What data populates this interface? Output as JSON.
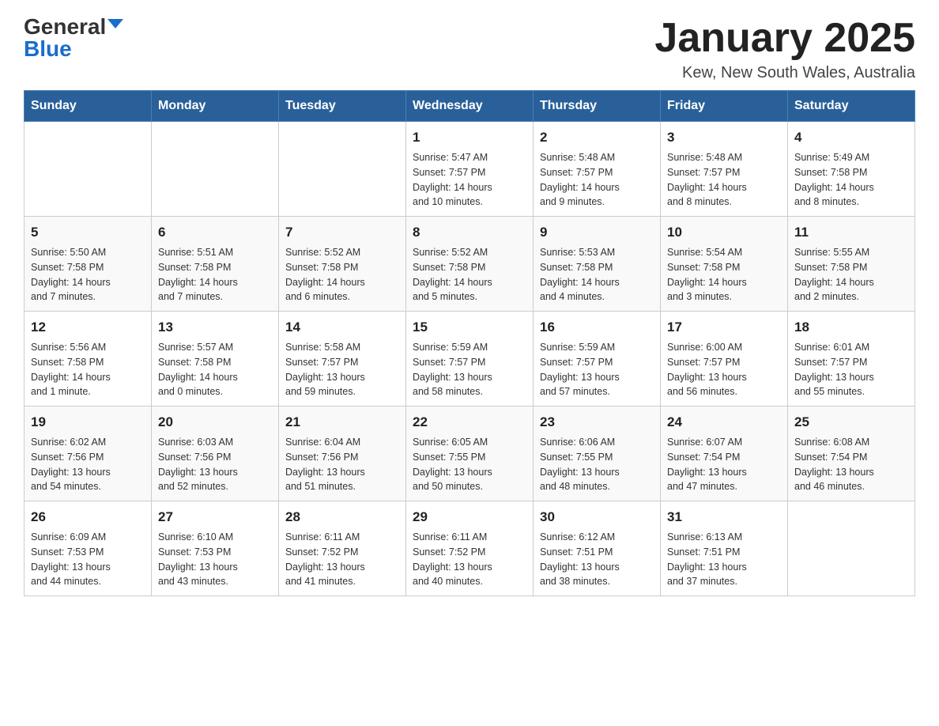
{
  "header": {
    "logo": {
      "general": "General",
      "blue": "Blue"
    },
    "month_title": "January 2025",
    "location": "Kew, New South Wales, Australia"
  },
  "days_of_week": [
    "Sunday",
    "Monday",
    "Tuesday",
    "Wednesday",
    "Thursday",
    "Friday",
    "Saturday"
  ],
  "weeks": [
    [
      {
        "day": "",
        "info": ""
      },
      {
        "day": "",
        "info": ""
      },
      {
        "day": "",
        "info": ""
      },
      {
        "day": "1",
        "info": "Sunrise: 5:47 AM\nSunset: 7:57 PM\nDaylight: 14 hours\nand 10 minutes."
      },
      {
        "day": "2",
        "info": "Sunrise: 5:48 AM\nSunset: 7:57 PM\nDaylight: 14 hours\nand 9 minutes."
      },
      {
        "day": "3",
        "info": "Sunrise: 5:48 AM\nSunset: 7:57 PM\nDaylight: 14 hours\nand 8 minutes."
      },
      {
        "day": "4",
        "info": "Sunrise: 5:49 AM\nSunset: 7:58 PM\nDaylight: 14 hours\nand 8 minutes."
      }
    ],
    [
      {
        "day": "5",
        "info": "Sunrise: 5:50 AM\nSunset: 7:58 PM\nDaylight: 14 hours\nand 7 minutes."
      },
      {
        "day": "6",
        "info": "Sunrise: 5:51 AM\nSunset: 7:58 PM\nDaylight: 14 hours\nand 7 minutes."
      },
      {
        "day": "7",
        "info": "Sunrise: 5:52 AM\nSunset: 7:58 PM\nDaylight: 14 hours\nand 6 minutes."
      },
      {
        "day": "8",
        "info": "Sunrise: 5:52 AM\nSunset: 7:58 PM\nDaylight: 14 hours\nand 5 minutes."
      },
      {
        "day": "9",
        "info": "Sunrise: 5:53 AM\nSunset: 7:58 PM\nDaylight: 14 hours\nand 4 minutes."
      },
      {
        "day": "10",
        "info": "Sunrise: 5:54 AM\nSunset: 7:58 PM\nDaylight: 14 hours\nand 3 minutes."
      },
      {
        "day": "11",
        "info": "Sunrise: 5:55 AM\nSunset: 7:58 PM\nDaylight: 14 hours\nand 2 minutes."
      }
    ],
    [
      {
        "day": "12",
        "info": "Sunrise: 5:56 AM\nSunset: 7:58 PM\nDaylight: 14 hours\nand 1 minute."
      },
      {
        "day": "13",
        "info": "Sunrise: 5:57 AM\nSunset: 7:58 PM\nDaylight: 14 hours\nand 0 minutes."
      },
      {
        "day": "14",
        "info": "Sunrise: 5:58 AM\nSunset: 7:57 PM\nDaylight: 13 hours\nand 59 minutes."
      },
      {
        "day": "15",
        "info": "Sunrise: 5:59 AM\nSunset: 7:57 PM\nDaylight: 13 hours\nand 58 minutes."
      },
      {
        "day": "16",
        "info": "Sunrise: 5:59 AM\nSunset: 7:57 PM\nDaylight: 13 hours\nand 57 minutes."
      },
      {
        "day": "17",
        "info": "Sunrise: 6:00 AM\nSunset: 7:57 PM\nDaylight: 13 hours\nand 56 minutes."
      },
      {
        "day": "18",
        "info": "Sunrise: 6:01 AM\nSunset: 7:57 PM\nDaylight: 13 hours\nand 55 minutes."
      }
    ],
    [
      {
        "day": "19",
        "info": "Sunrise: 6:02 AM\nSunset: 7:56 PM\nDaylight: 13 hours\nand 54 minutes."
      },
      {
        "day": "20",
        "info": "Sunrise: 6:03 AM\nSunset: 7:56 PM\nDaylight: 13 hours\nand 52 minutes."
      },
      {
        "day": "21",
        "info": "Sunrise: 6:04 AM\nSunset: 7:56 PM\nDaylight: 13 hours\nand 51 minutes."
      },
      {
        "day": "22",
        "info": "Sunrise: 6:05 AM\nSunset: 7:55 PM\nDaylight: 13 hours\nand 50 minutes."
      },
      {
        "day": "23",
        "info": "Sunrise: 6:06 AM\nSunset: 7:55 PM\nDaylight: 13 hours\nand 48 minutes."
      },
      {
        "day": "24",
        "info": "Sunrise: 6:07 AM\nSunset: 7:54 PM\nDaylight: 13 hours\nand 47 minutes."
      },
      {
        "day": "25",
        "info": "Sunrise: 6:08 AM\nSunset: 7:54 PM\nDaylight: 13 hours\nand 46 minutes."
      }
    ],
    [
      {
        "day": "26",
        "info": "Sunrise: 6:09 AM\nSunset: 7:53 PM\nDaylight: 13 hours\nand 44 minutes."
      },
      {
        "day": "27",
        "info": "Sunrise: 6:10 AM\nSunset: 7:53 PM\nDaylight: 13 hours\nand 43 minutes."
      },
      {
        "day": "28",
        "info": "Sunrise: 6:11 AM\nSunset: 7:52 PM\nDaylight: 13 hours\nand 41 minutes."
      },
      {
        "day": "29",
        "info": "Sunrise: 6:11 AM\nSunset: 7:52 PM\nDaylight: 13 hours\nand 40 minutes."
      },
      {
        "day": "30",
        "info": "Sunrise: 6:12 AM\nSunset: 7:51 PM\nDaylight: 13 hours\nand 38 minutes."
      },
      {
        "day": "31",
        "info": "Sunrise: 6:13 AM\nSunset: 7:51 PM\nDaylight: 13 hours\nand 37 minutes."
      },
      {
        "day": "",
        "info": ""
      }
    ]
  ]
}
